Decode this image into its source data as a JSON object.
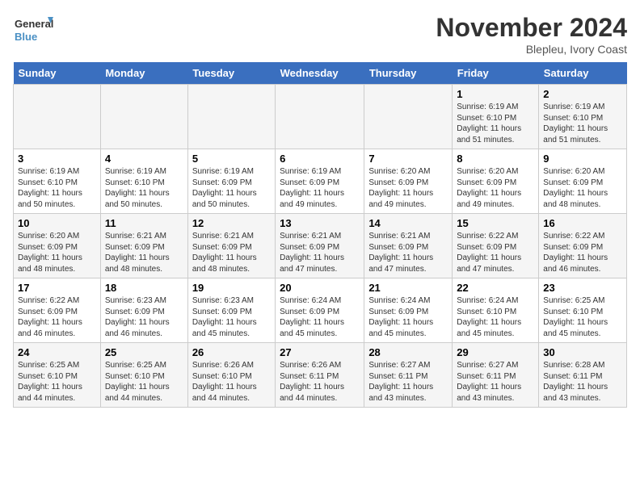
{
  "logo": {
    "text_general": "General",
    "text_blue": "Blue"
  },
  "title": "November 2024",
  "subtitle": "Blepleu, Ivory Coast",
  "days_of_week": [
    "Sunday",
    "Monday",
    "Tuesday",
    "Wednesday",
    "Thursday",
    "Friday",
    "Saturday"
  ],
  "weeks": [
    [
      {
        "day": "",
        "info": ""
      },
      {
        "day": "",
        "info": ""
      },
      {
        "day": "",
        "info": ""
      },
      {
        "day": "",
        "info": ""
      },
      {
        "day": "",
        "info": ""
      },
      {
        "day": "1",
        "info": "Sunrise: 6:19 AM\nSunset: 6:10 PM\nDaylight: 11 hours and 51 minutes."
      },
      {
        "day": "2",
        "info": "Sunrise: 6:19 AM\nSunset: 6:10 PM\nDaylight: 11 hours and 51 minutes."
      }
    ],
    [
      {
        "day": "3",
        "info": "Sunrise: 6:19 AM\nSunset: 6:10 PM\nDaylight: 11 hours and 50 minutes."
      },
      {
        "day": "4",
        "info": "Sunrise: 6:19 AM\nSunset: 6:10 PM\nDaylight: 11 hours and 50 minutes."
      },
      {
        "day": "5",
        "info": "Sunrise: 6:19 AM\nSunset: 6:09 PM\nDaylight: 11 hours and 50 minutes."
      },
      {
        "day": "6",
        "info": "Sunrise: 6:19 AM\nSunset: 6:09 PM\nDaylight: 11 hours and 49 minutes."
      },
      {
        "day": "7",
        "info": "Sunrise: 6:20 AM\nSunset: 6:09 PM\nDaylight: 11 hours and 49 minutes."
      },
      {
        "day": "8",
        "info": "Sunrise: 6:20 AM\nSunset: 6:09 PM\nDaylight: 11 hours and 49 minutes."
      },
      {
        "day": "9",
        "info": "Sunrise: 6:20 AM\nSunset: 6:09 PM\nDaylight: 11 hours and 48 minutes."
      }
    ],
    [
      {
        "day": "10",
        "info": "Sunrise: 6:20 AM\nSunset: 6:09 PM\nDaylight: 11 hours and 48 minutes."
      },
      {
        "day": "11",
        "info": "Sunrise: 6:21 AM\nSunset: 6:09 PM\nDaylight: 11 hours and 48 minutes."
      },
      {
        "day": "12",
        "info": "Sunrise: 6:21 AM\nSunset: 6:09 PM\nDaylight: 11 hours and 48 minutes."
      },
      {
        "day": "13",
        "info": "Sunrise: 6:21 AM\nSunset: 6:09 PM\nDaylight: 11 hours and 47 minutes."
      },
      {
        "day": "14",
        "info": "Sunrise: 6:21 AM\nSunset: 6:09 PM\nDaylight: 11 hours and 47 minutes."
      },
      {
        "day": "15",
        "info": "Sunrise: 6:22 AM\nSunset: 6:09 PM\nDaylight: 11 hours and 47 minutes."
      },
      {
        "day": "16",
        "info": "Sunrise: 6:22 AM\nSunset: 6:09 PM\nDaylight: 11 hours and 46 minutes."
      }
    ],
    [
      {
        "day": "17",
        "info": "Sunrise: 6:22 AM\nSunset: 6:09 PM\nDaylight: 11 hours and 46 minutes."
      },
      {
        "day": "18",
        "info": "Sunrise: 6:23 AM\nSunset: 6:09 PM\nDaylight: 11 hours and 46 minutes."
      },
      {
        "day": "19",
        "info": "Sunrise: 6:23 AM\nSunset: 6:09 PM\nDaylight: 11 hours and 45 minutes."
      },
      {
        "day": "20",
        "info": "Sunrise: 6:24 AM\nSunset: 6:09 PM\nDaylight: 11 hours and 45 minutes."
      },
      {
        "day": "21",
        "info": "Sunrise: 6:24 AM\nSunset: 6:09 PM\nDaylight: 11 hours and 45 minutes."
      },
      {
        "day": "22",
        "info": "Sunrise: 6:24 AM\nSunset: 6:10 PM\nDaylight: 11 hours and 45 minutes."
      },
      {
        "day": "23",
        "info": "Sunrise: 6:25 AM\nSunset: 6:10 PM\nDaylight: 11 hours and 45 minutes."
      }
    ],
    [
      {
        "day": "24",
        "info": "Sunrise: 6:25 AM\nSunset: 6:10 PM\nDaylight: 11 hours and 44 minutes."
      },
      {
        "day": "25",
        "info": "Sunrise: 6:25 AM\nSunset: 6:10 PM\nDaylight: 11 hours and 44 minutes."
      },
      {
        "day": "26",
        "info": "Sunrise: 6:26 AM\nSunset: 6:10 PM\nDaylight: 11 hours and 44 minutes."
      },
      {
        "day": "27",
        "info": "Sunrise: 6:26 AM\nSunset: 6:11 PM\nDaylight: 11 hours and 44 minutes."
      },
      {
        "day": "28",
        "info": "Sunrise: 6:27 AM\nSunset: 6:11 PM\nDaylight: 11 hours and 43 minutes."
      },
      {
        "day": "29",
        "info": "Sunrise: 6:27 AM\nSunset: 6:11 PM\nDaylight: 11 hours and 43 minutes."
      },
      {
        "day": "30",
        "info": "Sunrise: 6:28 AM\nSunset: 6:11 PM\nDaylight: 11 hours and 43 minutes."
      }
    ]
  ]
}
